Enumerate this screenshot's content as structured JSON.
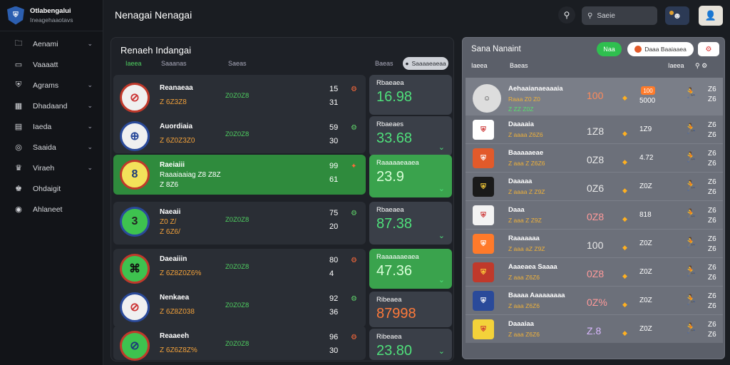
{
  "brand": {
    "line1": "Otlabengalui",
    "line2": "Ineagehaaotavs"
  },
  "sidebar": {
    "items": [
      {
        "label": "Aenami",
        "icon": "folder-icon",
        "chevron": "⌄"
      },
      {
        "label": "Vaaaatt",
        "icon": "chat-icon",
        "chevron": ""
      },
      {
        "label": "Agrams",
        "icon": "shield-icon",
        "chevron": "⌄"
      },
      {
        "label": "Dhadaand",
        "icon": "calendar-icon",
        "chevron": "⌄"
      },
      {
        "label": "Iaeda",
        "icon": "chart-icon",
        "chevron": "⌄"
      },
      {
        "label": "Saaida",
        "icon": "target-icon",
        "chevron": "⌄"
      },
      {
        "label": "Viraeh",
        "icon": "trophy-icon",
        "chevron": "⌄"
      },
      {
        "label": "Ohdaigit",
        "icon": "crown-icon",
        "chevron": ""
      },
      {
        "label": "Ahlaneet",
        "icon": "globe-icon",
        "chevron": ""
      }
    ]
  },
  "header": {
    "title": "Nenagai Nenagai",
    "search_placeholder": "Saeie"
  },
  "left": {
    "title": "Renaeh Indangai",
    "tabs": [
      "Iaeea",
      "Saaanas",
      "Saeas",
      "Baeas"
    ],
    "button": "Saaaaeaeaa",
    "matches": [
      {
        "name": "Reanaeaa",
        "sub": "Z 6Z3Z8",
        "odd": "Z0Z0Z8",
        "s1": "15",
        "s2": "31",
        "icon": "⚙"
      },
      {
        "name": "Auordiaia",
        "sub": "Z 6Z0Z3Z0",
        "odd": "Z0Z0Z8",
        "s1": "59",
        "s2": "30",
        "icon": "⚙"
      },
      {
        "name": "Raeiaiii",
        "sub": "Raaaiaaiag Z8 Z8Z",
        "sub2": "Z 8Z6",
        "odd": "",
        "s1": "99",
        "s2": "61",
        "icon": "✦"
      },
      {
        "name": "Naeaii",
        "sub": "Z0 Z/",
        "sub2": "Z 6Z6/",
        "odd": "Z0Z0Z8",
        "s1": "75",
        "s2": "20",
        "icon": "⚙"
      },
      {
        "name": "Daeaiiin",
        "sub": "Z 6Z8Z0Z6%",
        "odd": "Z0Z0Z8",
        "s1": "80",
        "s2": "4",
        "icon": "⚙"
      },
      {
        "name": "Nenkaea",
        "sub": "Z 6Z8Z038",
        "odd": "Z0Z0Z8",
        "s1": "92",
        "s2": "36",
        "icon": "⚙"
      },
      {
        "name": "Reaaeeh",
        "sub": "Z 6Z6Z8Z%",
        "odd": "Z0Z0Z8",
        "s1": "96",
        "s2": "30",
        "icon": "⚙"
      }
    ],
    "cards": [
      {
        "title": "Rbaeaea",
        "value": "16.98",
        "arrow": ""
      },
      {
        "title": "Rbaeaes",
        "value": "33.68",
        "arrow": "⌄"
      },
      {
        "title": "Raaaaaeaaea",
        "value": "23.9",
        "arrow": "⌄"
      },
      {
        "title": "Rbaeaea",
        "value": "87.38",
        "arrow": "⌄"
      },
      {
        "title": "Raaaaaaeaea",
        "value": "47.36",
        "arrow": "⌄"
      },
      {
        "title": "Ribeaea",
        "value": "87998",
        "arrow": ""
      },
      {
        "title": "Ribeaea",
        "value": "23.80",
        "arrow": "⌄"
      }
    ]
  },
  "right": {
    "title": "Sana Nanaint",
    "pill_green": "Naa",
    "pill_white": "Daaa Baaiaaea",
    "headers": [
      "Iaeea",
      "Baeas",
      "Iaeea"
    ],
    "rows": [
      {
        "name": "Aehaaianaeaaaia",
        "sub": "Raaa Z0 Z0",
        "sub2": "Z ZZ Z0Z",
        "odd": "100",
        "chip": "100",
        "n": "5000",
        "num1": "Z6",
        "num2": "Z6"
      },
      {
        "name": "Daaaaia",
        "sub": "Z aaaa Z6Z6",
        "odd": "1Z8",
        "n": "1Z9",
        "num1": "Z6",
        "num2": "Z6"
      },
      {
        "name": "Baaaaaeae",
        "sub": "Z aaa Z Z6Z6",
        "odd": "0Z8",
        "n": "4.72",
        "num1": "Z6",
        "num2": "Z6"
      },
      {
        "name": "Daaaaa",
        "sub": "Z aaaa Z Z9Z",
        "odd": "0Z6",
        "n": "Z0Z",
        "num1": "Z6",
        "num2": "Z6"
      },
      {
        "name": "Daaa",
        "sub": "Z aaa Z Z9Z",
        "odd": "0Z8",
        "n": "818",
        "num1": "Z6",
        "num2": "Z6"
      },
      {
        "name": "Raaaaaaa",
        "sub": "Z aaa aZ Z9Z",
        "odd": "100",
        "n": "Z0Z",
        "num1": "Z6",
        "num2": "Z6"
      },
      {
        "name": "Aaaeaea Saaaa",
        "sub": "Z aaa Z6Z6",
        "odd": "0Z8",
        "n": "Z0Z",
        "num1": "Z6",
        "num2": "Z6"
      },
      {
        "name": "Baaaa Aaaaaaaaa",
        "sub": "Z aaa Z6Z6",
        "odd": "0Z%",
        "n": "Z0Z",
        "num1": "Z6",
        "num2": "Z6"
      },
      {
        "name": "Daaaiaa",
        "sub": "Z aaa Z6Z6",
        "odd": "Z.8",
        "n": "Z0Z",
        "num1": "Z6",
        "num2": "Z6"
      }
    ]
  },
  "colors": {
    "accent_green": "#3aa34d",
    "accent_orange": "#ff7a3a",
    "panel_right": "#5b5f69"
  }
}
